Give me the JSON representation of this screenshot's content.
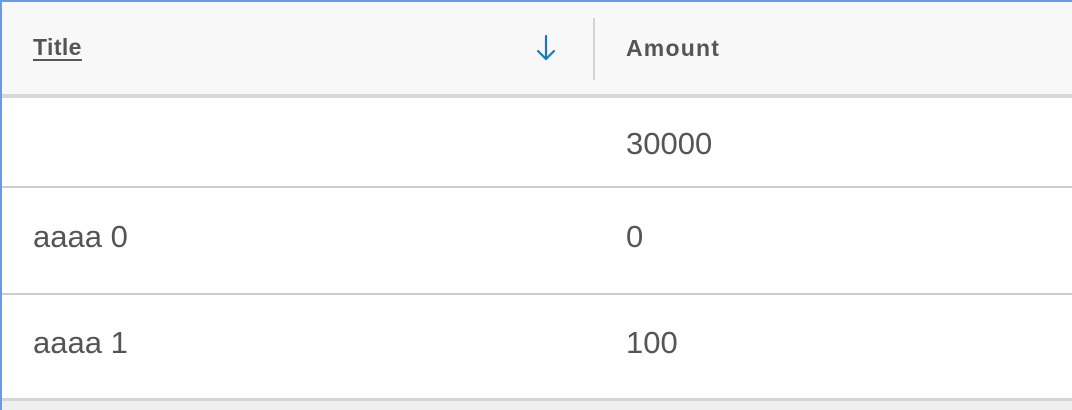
{
  "table": {
    "columns": [
      {
        "label": "Title",
        "sortable": true,
        "sorted": true,
        "sort_direction": "descending"
      },
      {
        "label": "Amount"
      }
    ],
    "sort_icon": "arrow-down-icon",
    "rows": [
      {
        "title": "",
        "amount": "30000"
      },
      {
        "title": "aaaa 0",
        "amount": "0"
      },
      {
        "title": "aaaa 1",
        "amount": "100"
      }
    ]
  },
  "colors": {
    "sort_icon": "#1a7bb5",
    "focus_border": "#6a9ae0",
    "text": "#555555",
    "header_bg": "#f8f8f8"
  }
}
